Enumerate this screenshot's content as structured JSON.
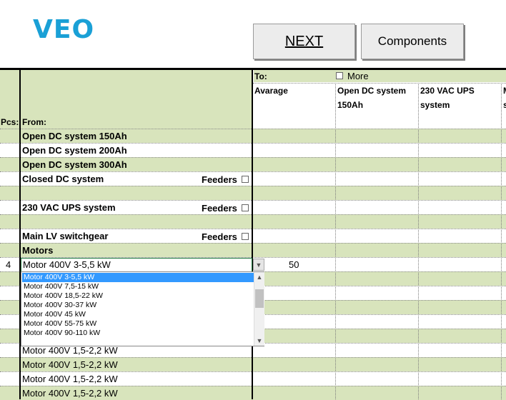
{
  "app": {
    "logo": "VEO"
  },
  "buttons": {
    "next": "NEXT",
    "components": "Components"
  },
  "header": {
    "pcs_label": "Pcs:",
    "from_label": "From:",
    "to_label": "To:",
    "more_label": "More",
    "columns": [
      {
        "line1": "Avarage",
        "line2": ""
      },
      {
        "line1": "Open DC system",
        "line2": "150Ah"
      },
      {
        "line1": "230 VAC UPS",
        "line2": "system"
      },
      {
        "line1": "M",
        "line2": "s"
      }
    ]
  },
  "rows": {
    "r1": "Open DC system 150Ah",
    "r2": "Open DC system 200Ah",
    "r3": "Open DC system 300Ah",
    "r4": "Closed DC system",
    "r6": "230 VAC UPS system",
    "r8": "Main LV switchgear",
    "r9": "Motors",
    "feeders": "Feeders"
  },
  "motor_row": {
    "pcs": "4",
    "selected": "Motor 400V 3-5,5 kW",
    "average": "50"
  },
  "dropdown": {
    "options": [
      "Motor 400V 3-5,5 kW",
      "Motor 400V 7,5-15 kW",
      "Motor 400V 18,5-22 kW",
      "Motor 400V 30-37 kW",
      "Motor 400V 45 kW",
      "Motor 400V 55-75 kW",
      "Motor 400V 90-110 kW"
    ]
  },
  "lower_rows": [
    "Motor 400V 1,5-2,2 kW",
    "Motor 400V 1,5-2,2 kW",
    "Motor 400V 1,5-2,2 kW",
    "Motor 400V 1,5-2,2 kW"
  ],
  "colors": {
    "header_green": "#d8e4bc",
    "logo_blue": "#1aa0d6",
    "selection_blue": "#3399ff"
  }
}
